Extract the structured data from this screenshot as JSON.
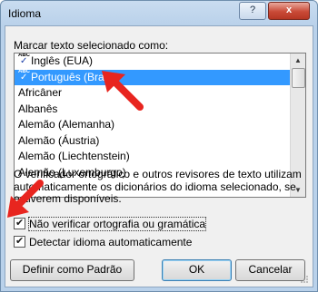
{
  "window": {
    "title": "Idioma",
    "help_label": "?",
    "close_label": "x"
  },
  "dialog": {
    "list_label": "Marcar texto selecionado como:",
    "languages": [
      {
        "label": "Inglês (EUA)",
        "spellcheck_icon": true,
        "selected": false
      },
      {
        "label": "Português (Brasil)",
        "spellcheck_icon": true,
        "selected": true
      },
      {
        "label": "Africâner",
        "spellcheck_icon": false,
        "selected": false
      },
      {
        "label": "Albanês",
        "spellcheck_icon": false,
        "selected": false
      },
      {
        "label": "Alemão (Alemanha)",
        "spellcheck_icon": false,
        "selected": false
      },
      {
        "label": "Alemão (Áustria)",
        "spellcheck_icon": false,
        "selected": false
      },
      {
        "label": "Alemão (Liechtenstein)",
        "spellcheck_icon": false,
        "selected": false
      },
      {
        "label": "Alemão (Luxemburgo)",
        "spellcheck_icon": false,
        "selected": false
      }
    ],
    "spellcheck_icon_text": "ABC",
    "info_text": "O verificador ortográfico e outros revisores de texto utilizam automaticamente os dicionários do idioma selecionado, se estiverem disponíveis.",
    "checkbox_no_spellcheck": {
      "label": "Não verificar ortografia ou gramática",
      "checked": true
    },
    "checkbox_detect": {
      "label": "Detectar idioma automaticamente",
      "checked": true
    }
  },
  "buttons": {
    "set_default": "Definir como Padrão",
    "ok": "OK",
    "cancel": "Cancelar"
  },
  "colors": {
    "selection": "#3399ff",
    "annotation_arrow": "#e8251f"
  },
  "icons": {
    "spellcheck": "abc-check-icon",
    "annotation": "red-arrow-icon"
  }
}
